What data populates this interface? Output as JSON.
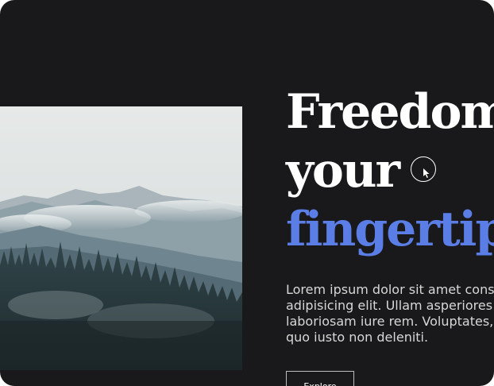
{
  "hero": {
    "headline_line1": "Freedom at",
    "headline_line2": "your",
    "headline_accent": "fingertips.",
    "body_line1": "Lorem ipsum dolor sit amet consectetur",
    "body_line2": "adipisicing elit. Ullam asperiores",
    "body_line3": "laboriosam iure rem. Voluptates,",
    "body_line4": "quo iusto non deleniti.",
    "button_label": "Explore"
  },
  "image": {
    "subject": "misty mountain forest"
  },
  "colors": {
    "background": "#19191b",
    "accent": "#5b7de6",
    "text": "#ffffff"
  },
  "icons": {
    "cursor": "pointer-cursor-icon"
  }
}
